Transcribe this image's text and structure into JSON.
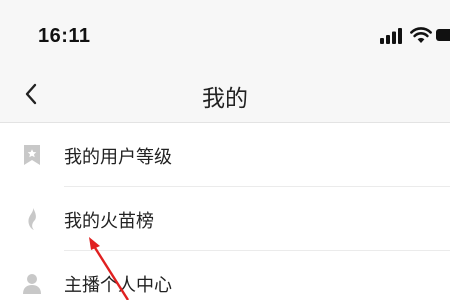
{
  "status_bar": {
    "time": "16:11",
    "icons": [
      "signal-icon",
      "wifi-icon",
      "battery-icon"
    ]
  },
  "nav": {
    "title": "我的",
    "back_icon": "chevron-left-icon"
  },
  "menu": {
    "items": [
      {
        "label": "我的用户等级",
        "icon": "bookmark-star-icon"
      },
      {
        "label": "我的火苗榜",
        "icon": "flame-icon"
      },
      {
        "label": "主播个人中心",
        "icon": "person-icon"
      }
    ]
  },
  "colors": {
    "header_bg": "#f7f7f7",
    "icon_gray": "#c8c8c8",
    "annotation_red": "#e02020"
  }
}
